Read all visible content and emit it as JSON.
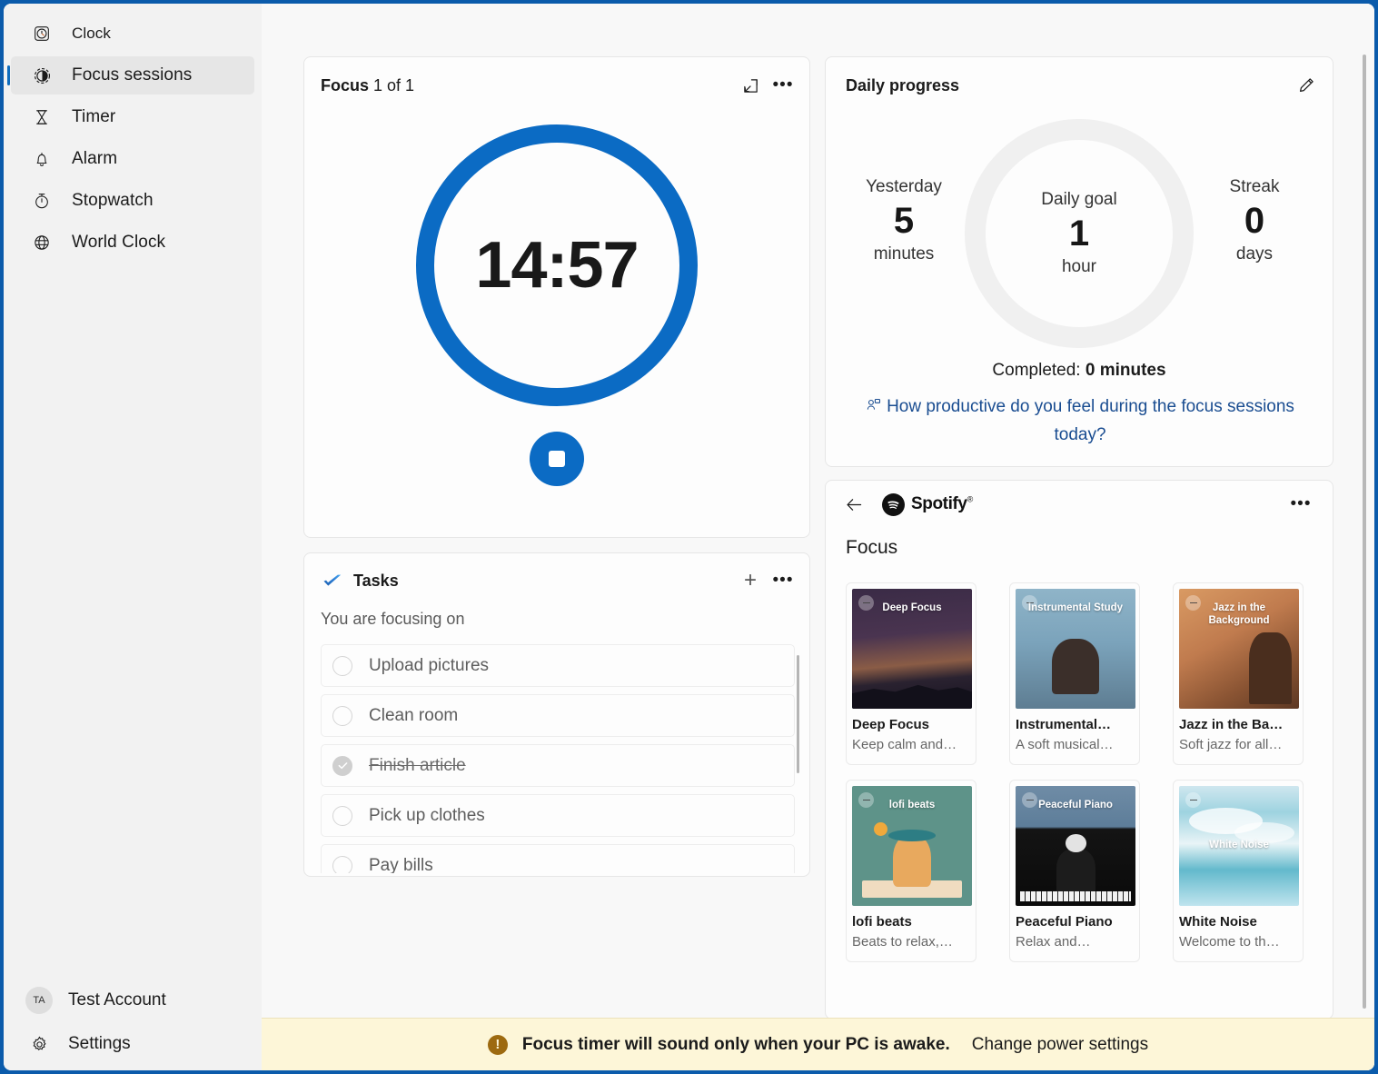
{
  "titlebar": {
    "minimize_label": "—",
    "maximize_label": "☐",
    "close_label": "✕"
  },
  "sidebar": {
    "items": [
      {
        "label": "Clock",
        "icon": "clock-icon",
        "selected": false
      },
      {
        "label": "Focus sessions",
        "icon": "focus-sessions-icon",
        "selected": true
      },
      {
        "label": "Timer",
        "icon": "hourglass-icon",
        "selected": false
      },
      {
        "label": "Alarm",
        "icon": "bell-icon",
        "selected": false
      },
      {
        "label": "Stopwatch",
        "icon": "stopwatch-icon",
        "selected": false
      },
      {
        "label": "World Clock",
        "icon": "globe-icon",
        "selected": false
      }
    ],
    "account": {
      "initials": "TA",
      "label": "Test Account"
    },
    "settings": {
      "label": "Settings",
      "icon": "gear-icon"
    }
  },
  "focus_card": {
    "title_bold": "Focus",
    "title_light": " 1 of 1",
    "popout_icon": "pop-out-icon",
    "more_icon": "more-options-icon",
    "timer": "14:57",
    "stop_button_label": "stop"
  },
  "tasks_card": {
    "title": "Tasks",
    "logo_icon": "microsoft-todo-icon",
    "add_label": "+",
    "more_icon": "more-options-icon",
    "subtitle": "You are focusing on",
    "items": [
      {
        "label": "Upload pictures",
        "done": false
      },
      {
        "label": "Clean room",
        "done": false
      },
      {
        "label": "Finish article",
        "done": true
      },
      {
        "label": "Pick up clothes",
        "done": false
      },
      {
        "label": "Pay bills",
        "done": false
      }
    ]
  },
  "progress_card": {
    "title": "Daily progress",
    "edit_icon": "pencil-icon",
    "yesterday": {
      "label": "Yesterday",
      "value": "5",
      "unit": "minutes"
    },
    "daily_goal": {
      "label": "Daily goal",
      "value": "1",
      "unit": "hour"
    },
    "streak": {
      "label": "Streak",
      "value": "0",
      "unit": "days"
    },
    "completed_prefix": "Completed: ",
    "completed_value": "0 minutes",
    "survey_link": "How productive do you feel during the focus sessions today?",
    "survey_icon": "feedback-icon",
    "progress_percent": 0,
    "ring_color": "#f0f0f0"
  },
  "spotify_card": {
    "back_icon": "back-arrow-icon",
    "brand": "Spotify",
    "brand_mark": "spotify-icon",
    "more_icon": "more-options-icon",
    "section_title": "Focus",
    "playlists": [
      {
        "name": "Deep Focus",
        "art_text": "Deep Focus",
        "desc": "Keep calm and…",
        "art_class": "art-deepfocus",
        "title_truncated": "Deep Focus"
      },
      {
        "name": "Instrumental Study",
        "art_text": "Instrumental Study",
        "desc": "A soft musical…",
        "art_class": "art-instrumental",
        "title_truncated": "Instrumental…"
      },
      {
        "name": "Jazz in the Background",
        "art_text": "Jazz in the Background",
        "desc": "Soft jazz for all…",
        "art_class": "art-jazz",
        "title_truncated": "Jazz in the Ba…"
      },
      {
        "name": "lofi beats",
        "art_text": "lofi beats",
        "desc": "Beats to relax,…",
        "art_class": "art-lofi",
        "title_truncated": "lofi beats"
      },
      {
        "name": "Peaceful Piano",
        "art_text": "Peaceful Piano",
        "desc": "Relax and…",
        "art_class": "art-piano",
        "title_truncated": "Peaceful Piano"
      },
      {
        "name": "White Noise",
        "art_text": "White Noise",
        "desc": "Welcome to th…",
        "art_class": "art-whitenoise",
        "title_truncated": "White Noise"
      }
    ]
  },
  "notification": {
    "icon": "warning-icon",
    "icon_glyph": "!",
    "text": "Focus timer will sound only when your PC is awake.",
    "link": "Change power settings",
    "background": "#fdf6d8"
  },
  "theme": {
    "accent": "#0b6bc4",
    "sidebar_bg": "#f2f2f2",
    "content_bg": "#f8f8f8",
    "card_bg": "#fdfdfd",
    "window_border": "#0b5bab"
  }
}
